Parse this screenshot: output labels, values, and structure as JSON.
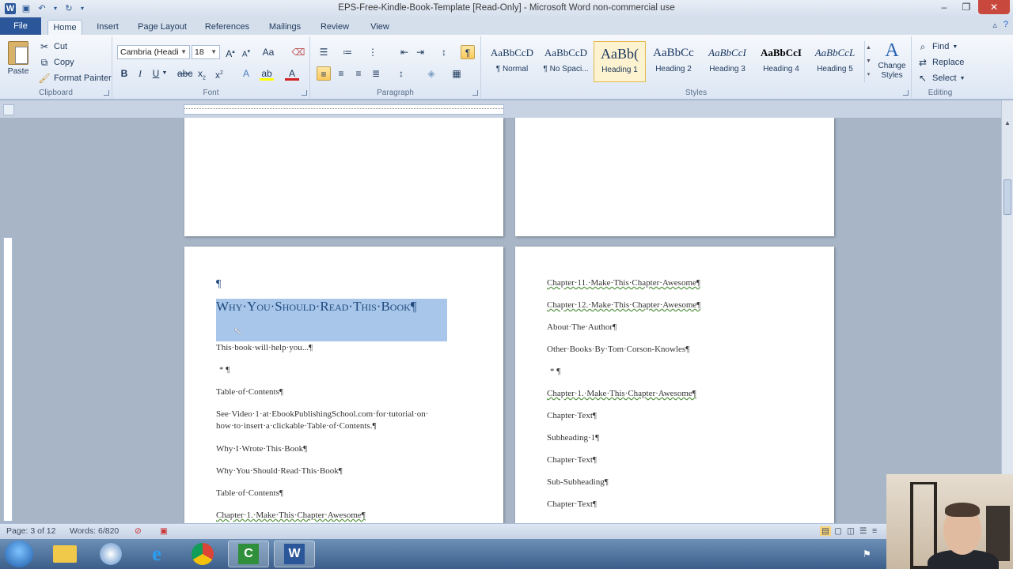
{
  "window": {
    "title": "EPS-Free-Kindle-Book-Template [Read-Only] - Microsoft Word non-commercial use"
  },
  "tabs": [
    {
      "label": "File"
    },
    {
      "label": "Home"
    },
    {
      "label": "Insert"
    },
    {
      "label": "Page Layout"
    },
    {
      "label": "References"
    },
    {
      "label": "Mailings"
    },
    {
      "label": "Review"
    },
    {
      "label": "View"
    }
  ],
  "clipboard": {
    "paste": "Paste",
    "cut": "Cut",
    "copy": "Copy",
    "format_painter": "Format Painter",
    "label": "Clipboard"
  },
  "font": {
    "family": "Cambria (Headi",
    "size": "18",
    "label": "Font"
  },
  "paragraph": {
    "label": "Paragraph"
  },
  "styles": {
    "label": "Styles",
    "change_styles": "Change Styles",
    "items": [
      {
        "sample": "AaBbCcD",
        "name": "¶ Normal"
      },
      {
        "sample": "AaBbCcD",
        "name": "¶ No Spaci..."
      },
      {
        "sample": "AaBb(",
        "name": "Heading 1"
      },
      {
        "sample": "AaBbCc",
        "name": "Heading 2"
      },
      {
        "sample": "AaBbCcI",
        "name": "Heading 3"
      },
      {
        "sample": "AaBbCcI",
        "name": "Heading 4"
      },
      {
        "sample": "AaBbCcL",
        "name": "Heading 5"
      }
    ]
  },
  "editing": {
    "find": "Find",
    "replace": "Replace",
    "select": "Select",
    "label": "Editing"
  },
  "page_left": {
    "pilcrow": "¶",
    "heading": "Why·You·Should·Read·This·Book¶",
    "lines": [
      "This·book·will·help·you...¶",
      "* ¶",
      "Table·of·Contents¶",
      "See·Video·1·at·EbookPublishingSchool.com·for·tutorial·on·",
      "how·to·insert·a·clickable·Table·of·Contents.¶",
      "Why·I·Wrote·This·Book¶",
      "Why·You·Should·Read·This·Book¶",
      "Table·of·Contents¶",
      "Chapter·1.·Make·This·Chapter·Awesome¶"
    ]
  },
  "page_right": {
    "lines": [
      "Chapter·11.·Make·This·Chapter·Awesome¶",
      "Chapter·12.·Make·This·Chapter·Awesome¶",
      "About·The·Author¶",
      "Other·Books·By·Tom·Corson-Knowles¶",
      "* ¶",
      "Chapter·1.·Make·This·Chapter·Awesome¶",
      "Chapter·Text¶",
      "Subheading·1¶",
      "Chapter·Text¶",
      "Sub-Subheading¶",
      "Chapter·Text¶"
    ]
  },
  "status": {
    "page": "Page: 3 of 12",
    "words": "Words: 6/820"
  },
  "taskbar": {
    "items": [
      "windows-explorer",
      "media",
      "internet-explorer",
      "chrome",
      "camtasia",
      "word"
    ]
  }
}
